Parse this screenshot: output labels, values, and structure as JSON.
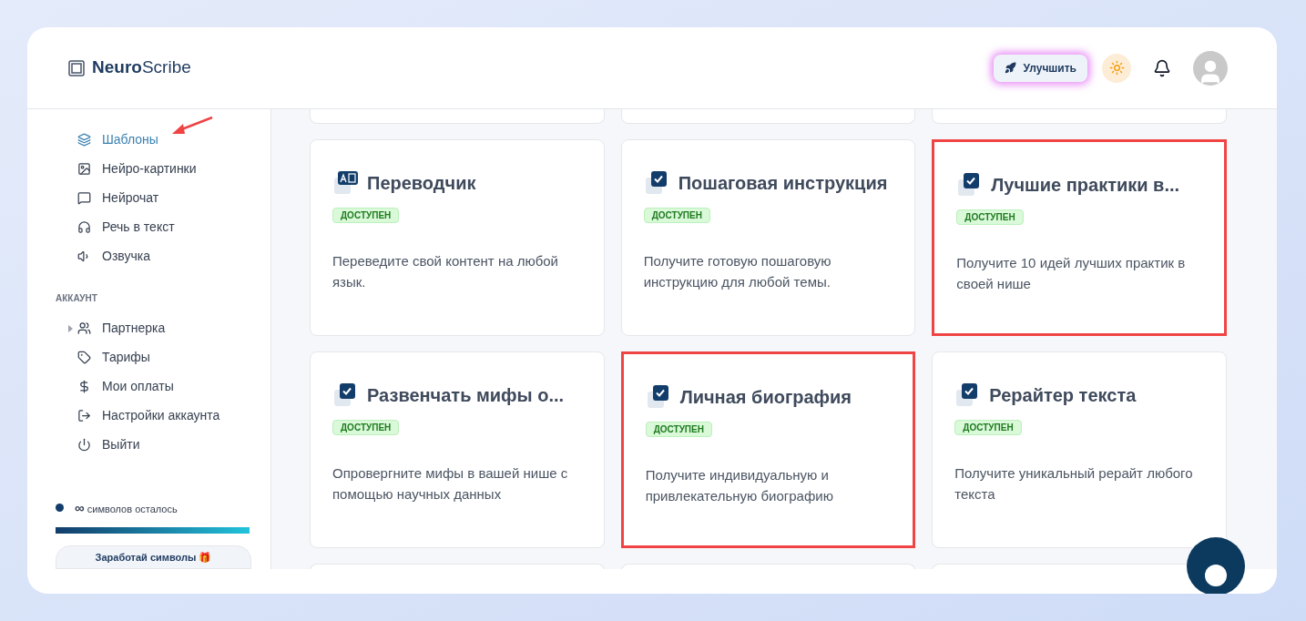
{
  "logo": {
    "bold": "Neuro",
    "rest": "Scribe"
  },
  "header": {
    "upgrade_button": "Улучшить"
  },
  "sidebar": {
    "items": [
      {
        "label": "Шаблоны",
        "selected": true
      },
      {
        "label": "Нейро-картинки",
        "selected": false
      },
      {
        "label": "Нейрочат",
        "selected": false
      },
      {
        "label": "Речь в текст",
        "selected": false
      },
      {
        "label": "Озвучка",
        "selected": false
      }
    ],
    "account": {
      "heading": "АККАУНТ",
      "items": [
        {
          "label": "Партнерка",
          "kind": "group",
          "expanded": false
        },
        {
          "label": "Тарифы",
          "kind": "link"
        },
        {
          "label": "Мои оплаты",
          "kind": "link"
        },
        {
          "label": "Настройки аккаунта",
          "kind": "link"
        },
        {
          "label": "Выйти",
          "kind": "link"
        }
      ]
    },
    "credits": {
      "amount": "∞",
      "label": "символов осталось",
      "level": 1
    },
    "earn_button": "Заработай символы 🎁"
  },
  "cards": [
    {
      "kind": "translate",
      "title": "Переводчик",
      "badge": "ДОСТУПЕН",
      "description": "Переведите свой контент на любой язык.",
      "highlighted": false
    },
    {
      "kind": "check",
      "title": "Пошаговая инструкция",
      "badge": "ДОСТУПЕН",
      "description": "Получите готовую пошаговую инструкцию для любой темы.",
      "highlighted": false
    },
    {
      "kind": "check",
      "title": "Лучшие практики в...",
      "badge": "ДОСТУПЕН",
      "description": "Получите 10 идей лучших практик в своей нише",
      "highlighted": true
    },
    {
      "kind": "check",
      "title": "Развенчать мифы о...",
      "badge": "ДОСТУПЕН",
      "description": "Опровергните мифы в вашей нише с помощью научных данных",
      "highlighted": false
    },
    {
      "kind": "check",
      "title": "Личная биография",
      "badge": "ДОСТУПЕН",
      "description": "Получите индивидуальную и привлекательную биографию",
      "highlighted": true
    },
    {
      "kind": "check",
      "title": "Рерайтер текста",
      "badge": "ДОСТУПЕН",
      "description": "Получите уникальный рерайт любого текста",
      "highlighted": false
    }
  ]
}
